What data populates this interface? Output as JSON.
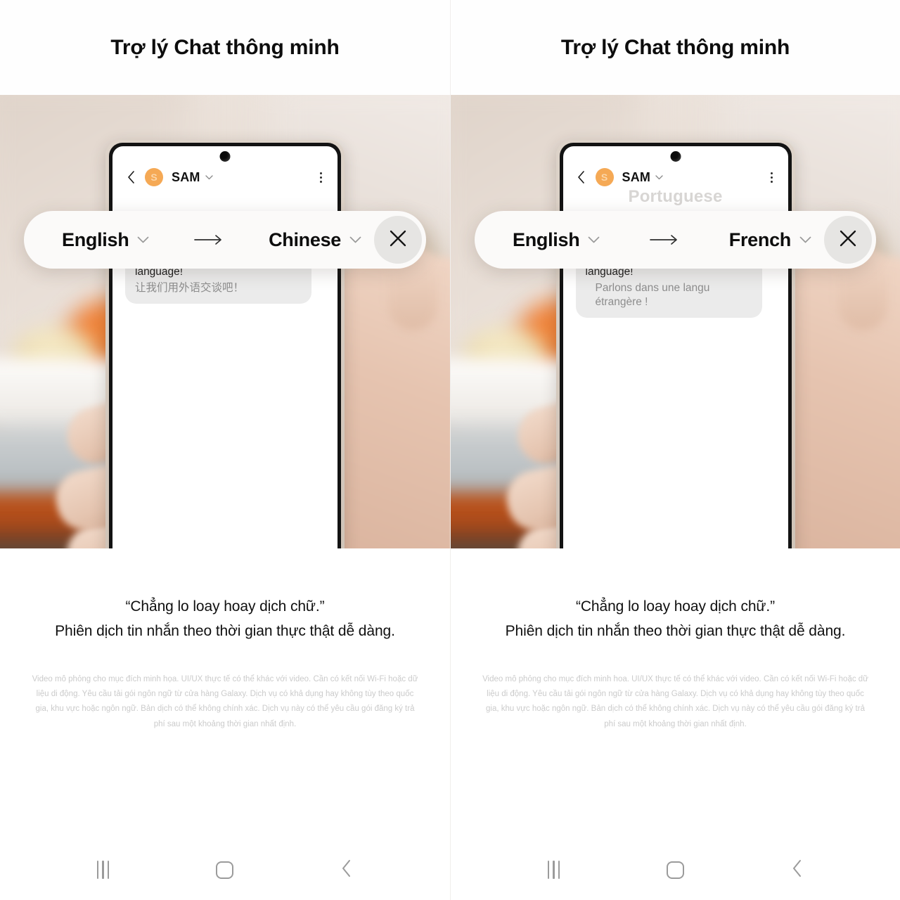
{
  "panels": [
    {
      "heading": "Trợ lý Chat thông minh",
      "phone": {
        "header": {
          "back_icon": "chevron-left-icon",
          "avatar_letter": "S",
          "contact_name": "SAM",
          "name_chevron_icon": "chevron-down-icon",
          "menu_icon": "kebab-menu-icon"
        },
        "ghost_language": "",
        "bubble": {
          "source_text": "Let's have a talk in a foreign language!",
          "translated_text": "让我们用外语交谈吧！",
          "translated_indent": false
        }
      },
      "pill": {
        "source_language": "English",
        "target_language": "Chinese",
        "arrow_icon": "arrow-right-icon",
        "source_chevron_icon": "chevron-down-icon",
        "target_chevron_icon": "chevron-down-icon",
        "close_icon": "close-x-icon"
      },
      "caption": {
        "quote": "“Chẳng lo loay hoay dịch chữ.”",
        "subtitle": "Phiên dịch tin nhắn theo thời gian thực thật dễ dàng."
      },
      "disclaimer": "Video mô phỏng cho mục đích minh họa. UI/UX thực tế có thể khác với video. Cần có kết nối Wi-Fi hoặc dữ liệu di động. Yêu cầu tải gói ngôn ngữ từ cửa hàng Galaxy. Dịch vụ có khả dụng hay không tùy theo quốc gia, khu vực hoặc ngôn ngữ. Bản dịch có thể không chính xác. Dịch vụ này có thể yêu cầu gói đăng ký trả phí sau một khoảng thời gian nhất định.",
      "navbar": {
        "recents_icon": "recents-icon",
        "home_icon": "home-square-icon",
        "back_icon": "back-chevron-icon"
      }
    },
    {
      "heading": "Trợ lý Chat thông minh",
      "phone": {
        "header": {
          "back_icon": "chevron-left-icon",
          "avatar_letter": "S",
          "contact_name": "SAM",
          "name_chevron_icon": "chevron-down-icon",
          "menu_icon": "kebab-menu-icon"
        },
        "ghost_language": "Portuguese",
        "bubble": {
          "source_text": "Let's have a talk in a foreign language!",
          "translated_text": "Parlons dans une langu étrangère !",
          "translated_indent": true
        }
      },
      "pill": {
        "source_language": "English",
        "target_language": "French",
        "arrow_icon": "arrow-right-icon",
        "source_chevron_icon": "chevron-down-icon",
        "target_chevron_icon": "chevron-down-icon",
        "close_icon": "close-x-icon"
      },
      "caption": {
        "quote": "“Chẳng lo loay hoay dịch chữ.”",
        "subtitle": "Phiên dịch tin nhắn theo thời gian thực thật dễ dàng."
      },
      "disclaimer": "Video mô phỏng cho mục đích minh hoa. UI/UX thực tế có thể khác với video. Cần có kết nối Wi-Fi hoặc dữ liệu di động. Yêu cầu tải gói ngôn ngữ từ cửa hàng Galaxy. Dịch vụ có khả dụng hay không tùy theo quốc gia, khu vực hoặc ngôn ngữ. Bản dịch có thể không chính xác. Dịch vụ này có thể yêu cầu gói đăng ký trả phí sau một khoảng thời gian nhất định.",
      "navbar": {
        "recents_icon": "recents-icon",
        "home_icon": "home-square-icon",
        "back_icon": "back-chevron-icon"
      }
    }
  ],
  "colors": {
    "avatar_orange": "#f5a955",
    "bubble_gray": "#ebebeb",
    "pill_white": "#fbfaf9",
    "close_button_gray": "#e6e5e3",
    "text_primary": "#0d0d0d",
    "text_muted": "#8d8d8d",
    "disclaimer_gray": "#cbcbcb",
    "nav_gray": "#9b9b9b"
  }
}
